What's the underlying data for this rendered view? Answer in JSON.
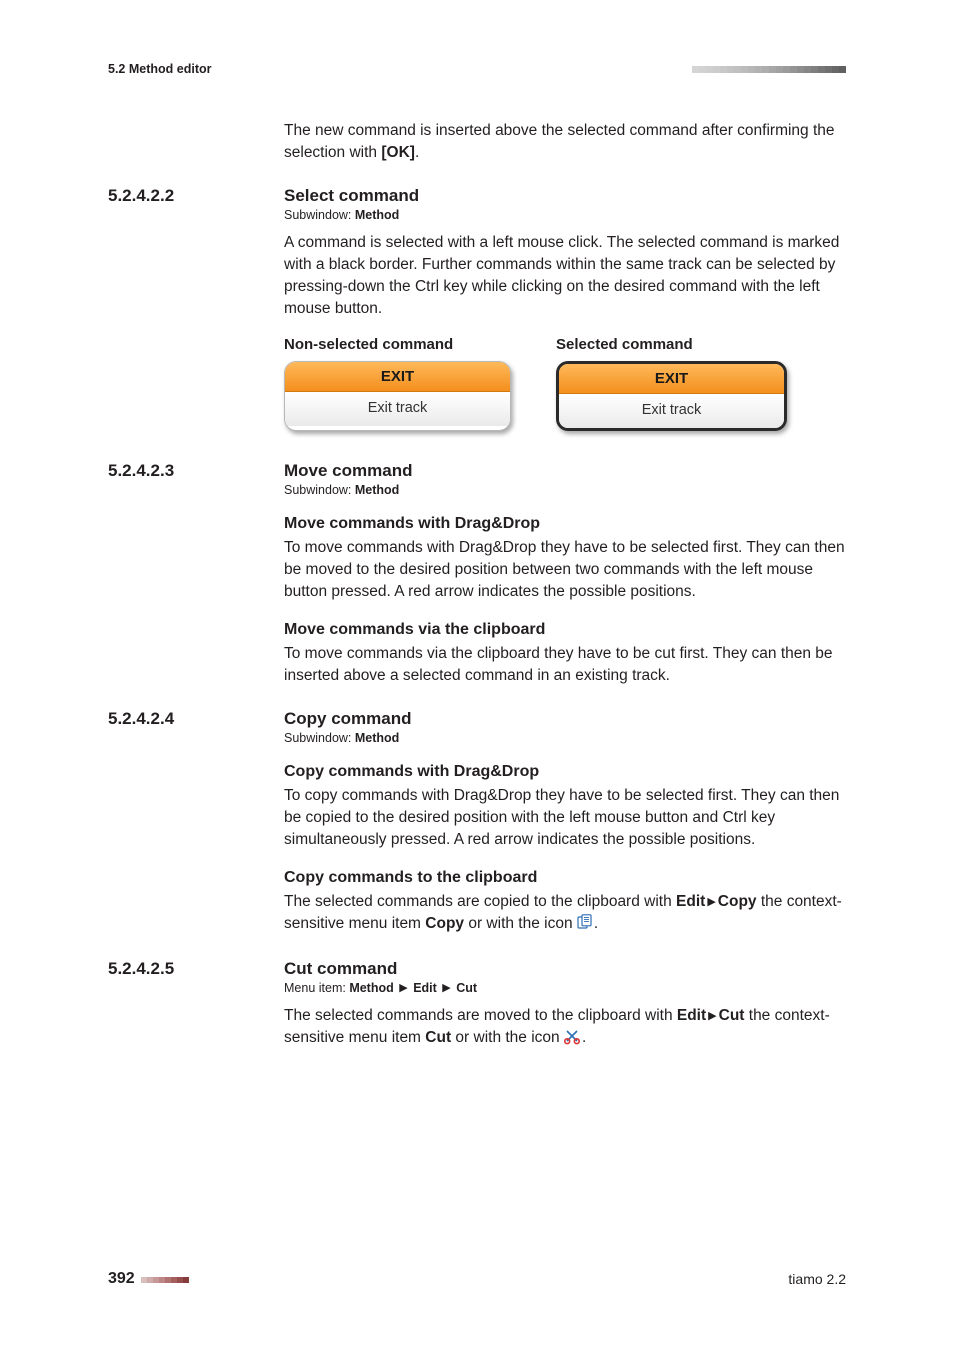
{
  "header": {
    "section_label": "5.2 Method editor"
  },
  "intro": {
    "line": "The new command is inserted above the selected command after confirming the selection with ",
    "ok": "[OK]",
    "period": "."
  },
  "sec_select": {
    "num": "5.2.4.2.2",
    "title": "Select command",
    "subwindow_prefix": "Subwindow: ",
    "subwindow_value": "Method",
    "para": "A command is selected with a left mouse click. The selected command is marked with a black border. Further commands within the same track can be selected by pressing-down the Ctrl key while clicking on the desired command with the left mouse button.",
    "fig": {
      "left_label": "Non-selected command",
      "right_label": "Selected command",
      "box_head": "EXIT",
      "box_body": "Exit track"
    }
  },
  "sec_move": {
    "num": "5.2.4.2.3",
    "title": "Move command",
    "subwindow_prefix": "Subwindow: ",
    "subwindow_value": "Method",
    "h1": "Move commands with Drag&Drop",
    "p1": "To move commands with Drag&Drop they have to be selected first. They can then be moved to the desired position between two commands with the left mouse button pressed. A red arrow indicates the possible positions.",
    "h2": "Move commands via the clipboard",
    "p2": "To move commands via the clipboard they have to be cut first. They can then be inserted above a selected command in an existing track."
  },
  "sec_copy": {
    "num": "5.2.4.2.4",
    "title": "Copy command",
    "subwindow_prefix": "Subwindow: ",
    "subwindow_value": "Method",
    "h1": "Copy commands with Drag&Drop",
    "p1": "To copy commands with Drag&Drop they have to be selected first. They can then be copied to the desired position with the left mouse button and Ctrl key simultaneously pressed. A red arrow indicates the possible positions.",
    "h2": "Copy commands to the clipboard",
    "p2a": "The selected commands are copied to the clipboard with ",
    "menu_edit": "Edit",
    "menu_copy": "Copy",
    "p2b": " the context-sensitive menu item ",
    "copy_word": "Copy",
    "p2c": " or with the icon ",
    "period": "."
  },
  "sec_cut": {
    "num": "5.2.4.2.5",
    "title": "Cut command",
    "menu_prefix": "Menu item: ",
    "menu_method": "Method",
    "menu_edit": "Edit",
    "menu_cut": "Cut",
    "p_a": "The selected commands are moved to the clipboard with ",
    "p_edit": "Edit",
    "p_cut": "Cut",
    "p_b": " the context-sensitive menu item ",
    "cut_word": "Cut",
    "p_c": " or with the icon ",
    "period": "."
  },
  "footer": {
    "page": "392",
    "product": "tiamo 2.2"
  },
  "colors": {
    "header_grad": [
      "#c7c7c7",
      "#8f8f8f",
      "#6b6b6b"
    ],
    "footer_grad": [
      "#cfa9a9",
      "#b36b6b",
      "#8e3a3a",
      "#6d1f1f"
    ]
  }
}
